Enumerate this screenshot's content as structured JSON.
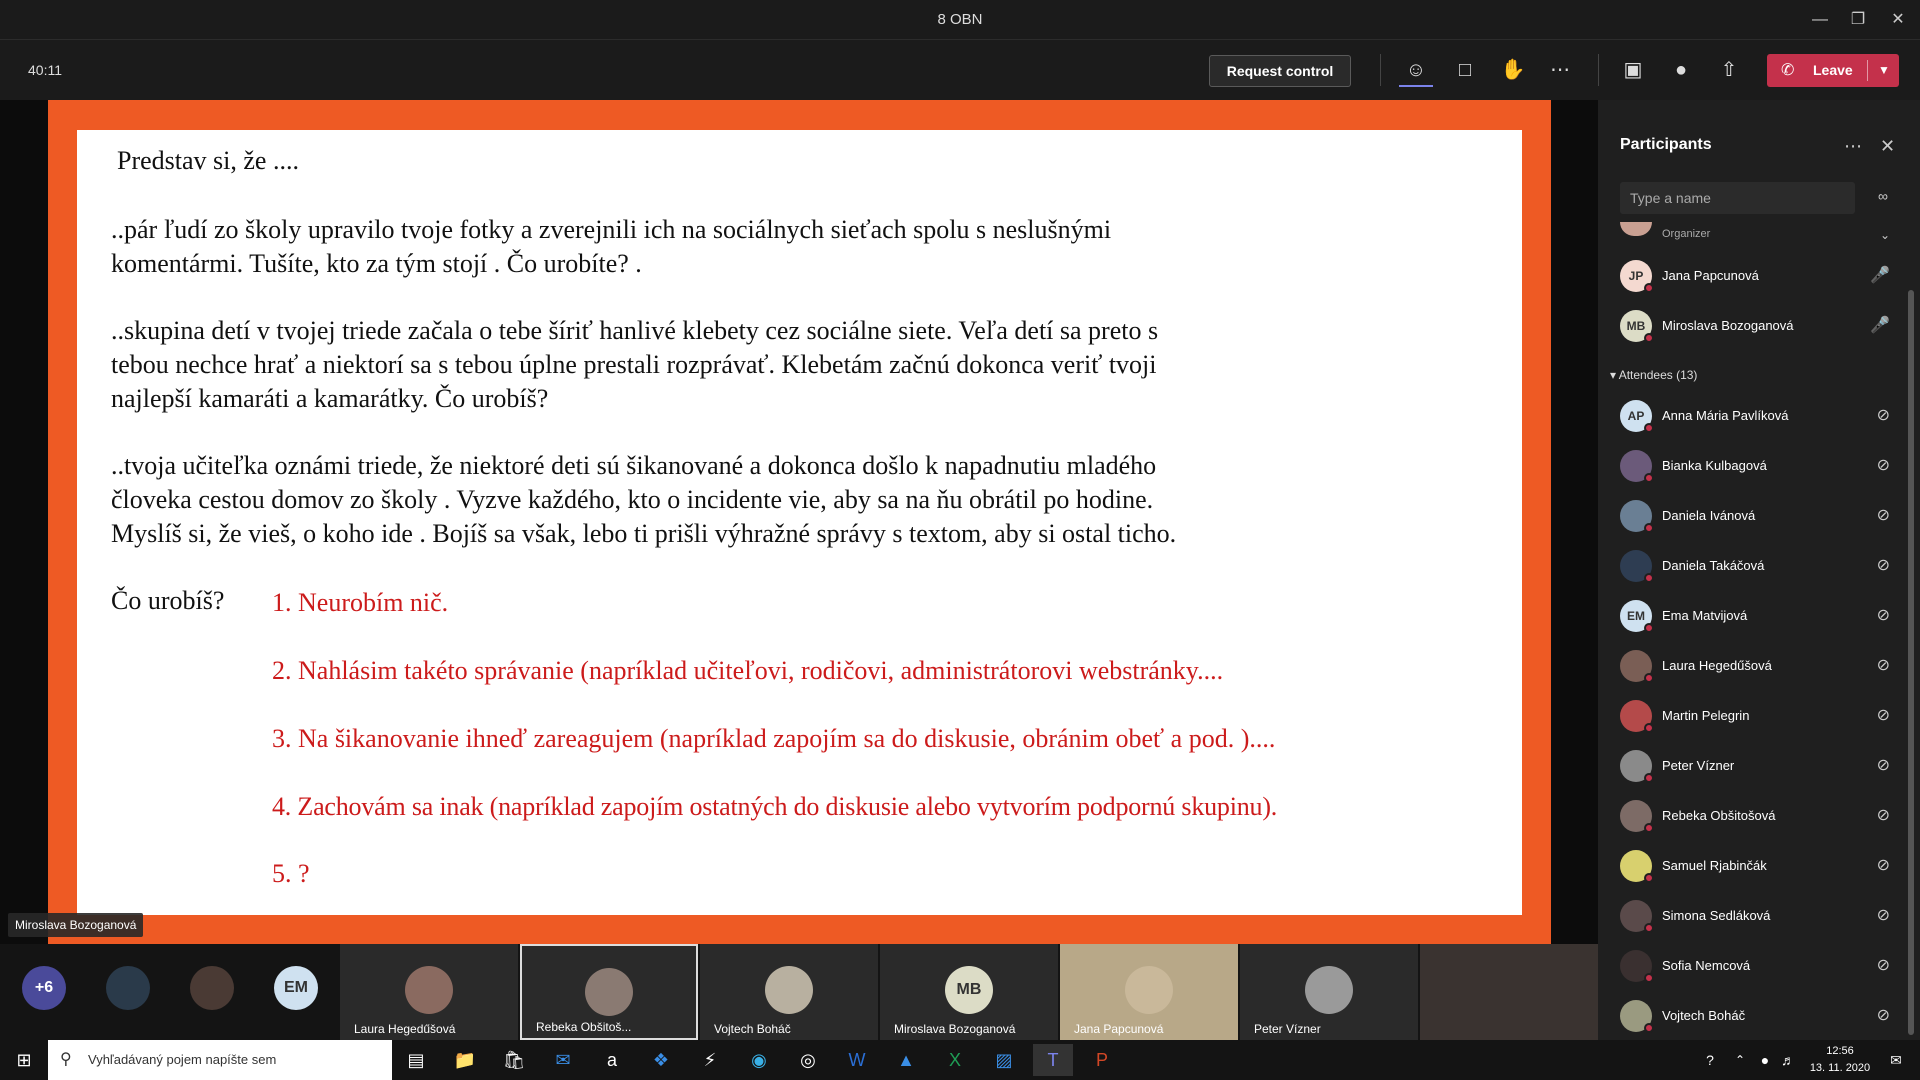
{
  "window": {
    "title": "8 OBN"
  },
  "toolbar": {
    "timer": "40:11",
    "request_control": "Request control",
    "leave_label": "Leave"
  },
  "slide": {
    "heading": " Predstav si, že ....",
    "p1": [
      "..pár ľudí zo školy upravilo tvoje fotky a zverejnili ich na sociálnych sieťach spolu s neslušnými",
      "komentármi. Tušíte, kto za tým stojí . Čo urobíte? ."
    ],
    "p2": [
      "..skupina detí v tvojej triede začala o tebe šíriť hanlivé klebety cez sociálne siete. Veľa detí sa preto s",
      "tebou nechce hrať a niektorí sa s tebou úplne prestali rozprávať. Klebetám začnú dokonca veriť tvoji",
      "najlepší kamaráti a kamarátky. Čo urobíš?"
    ],
    "p3": [
      "..tvoja učiteľka oznámi triede, že niektoré deti sú šikanované a dokonca došlo k napadnutiu mladého",
      "človeka cestou domov zo školy . Vyzve každého, kto o incidente vie, aby sa na ňu obrátil po hodine.",
      "Myslíš si, že vieš, o koho ide . Bojíš sa však, lebo ti prišli výhražné správy s textom, aby si ostal ticho."
    ],
    "question": "Čo urobíš?",
    "options": [
      "1. Neurobím nič.",
      "2. Nahlásim takéto správanie (napríklad učiteľovi, rodičovi, administrátorovi webstránky....",
      "3. Na šikanovanie ihneď zareagujem (napríklad zapojím sa do diskusie, obránim obeť a pod. )....",
      "4. Zachovám sa inak (napríklad zapojím ostatných do diskusie alebo vytvorím podpornú skupinu).",
      "5. ?"
    ]
  },
  "presenter_tag": "Miroslava Bozoganová",
  "panel": {
    "title": "Participants",
    "search_placeholder": "Type a name",
    "organizer_label": "Organizer",
    "organizers": [
      {
        "initials": "JP",
        "name": "Jana Papcunová",
        "bg": "#f4d9d0"
      },
      {
        "initials": "MB",
        "name": "Miroslava Bozoganová",
        "bg": "#dcdcc6"
      }
    ],
    "attendees_label": "Attendees (13)",
    "attendees": [
      {
        "initials": "AP",
        "name": "Anna Mária Pavlíková",
        "bg": "#cfe1f0"
      },
      {
        "initials": "",
        "name": "Bianka Kulbagová",
        "bg": "#6b5a7a"
      },
      {
        "initials": "",
        "name": "Daniela Ivánová",
        "bg": "#6a7f94"
      },
      {
        "initials": "",
        "name": "Daniela Takáčová",
        "bg": "#2e3d52"
      },
      {
        "initials": "EM",
        "name": "Ema Matvijová",
        "bg": "#cfe1f0"
      },
      {
        "initials": "",
        "name": "Laura Hegedűšová",
        "bg": "#7a5e55"
      },
      {
        "initials": "",
        "name": "Martin Pelegrin",
        "bg": "#b44a4a"
      },
      {
        "initials": "",
        "name": "Peter Vízner",
        "bg": "#8a8a8a"
      },
      {
        "initials": "",
        "name": "Rebeka Obšitošová",
        "bg": "#7d6b66"
      },
      {
        "initials": "",
        "name": "Samuel Rjabinčák",
        "bg": "#d8d06e"
      },
      {
        "initials": "",
        "name": "Simona Sedláková",
        "bg": "#5a4a4a"
      },
      {
        "initials": "",
        "name": "Sofia Nemcová",
        "bg": "#3a3030"
      },
      {
        "initials": "",
        "name": "Vojtech Boháč",
        "bg": "#9a9a80"
      }
    ]
  },
  "strip": {
    "more": "+6",
    "em": "EM",
    "tiles": [
      {
        "name": "Laura Hegedűšová",
        "initials": "",
        "bg": "#8a6a60"
      },
      {
        "name": "Rebeka Obšitoš...",
        "initials": "",
        "bg": "#8a7a72"
      },
      {
        "name": "Vojtech Boháč",
        "initials": "",
        "bg": "#b8b0a0"
      },
      {
        "name": "Miroslava Bozoganová",
        "initials": "MB",
        "bg": "#dcdcc6"
      },
      {
        "name": "Jana Papcunová",
        "initials": "",
        "bg": "#c9b89a"
      },
      {
        "name": "Peter Vízner",
        "initials": "",
        "bg": "#9a9a9a"
      }
    ]
  },
  "taskbar": {
    "search_text": "Vyhľadávaný pojem napíšte sem",
    "time": "12:56",
    "date": "13. 11. 2020"
  }
}
